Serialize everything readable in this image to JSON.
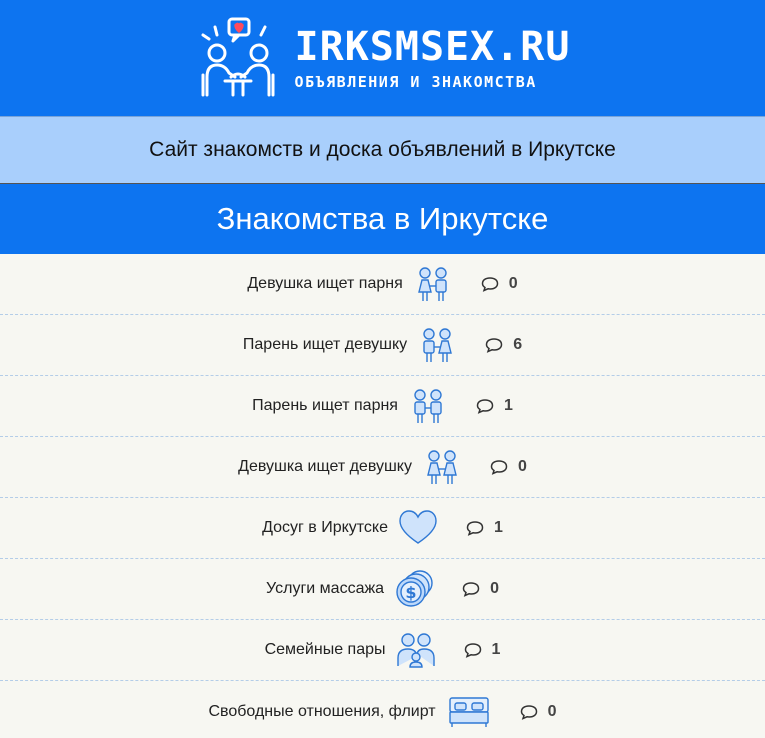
{
  "header": {
    "logo_title": "IRKSMSEX.RU",
    "logo_subtitle": "ОБЪЯВЛЕНИЯ И ЗНАКОМСТВА",
    "brand_color": "#0d74f0"
  },
  "subheader": {
    "text": "Сайт знакомств и доска объявлений в Иркутске",
    "bg_color": "#a9cffc"
  },
  "section": {
    "title": "Знакомства в Иркутске"
  },
  "categories": [
    {
      "label": "Девушка ищет парня",
      "icon": "couple-girl-boy-icon",
      "comments": "0"
    },
    {
      "label": "Парень ищет девушку",
      "icon": "couple-boy-girl-icon",
      "comments": "6"
    },
    {
      "label": "Парень ищет парня",
      "icon": "couple-boy-boy-icon",
      "comments": "1"
    },
    {
      "label": "Девушка ищет девушку",
      "icon": "couple-girl-girl-icon",
      "comments": "0"
    },
    {
      "label": "Досуг в Иркутске",
      "icon": "heart-icon",
      "comments": "1"
    },
    {
      "label": "Услуги массажа",
      "icon": "dollar-coins-icon",
      "comments": "0"
    },
    {
      "label": "Семейные пары",
      "icon": "family-icon",
      "comments": "1"
    },
    {
      "label": "Свободные отношения, флирт",
      "icon": "bed-icon",
      "comments": "0"
    }
  ]
}
